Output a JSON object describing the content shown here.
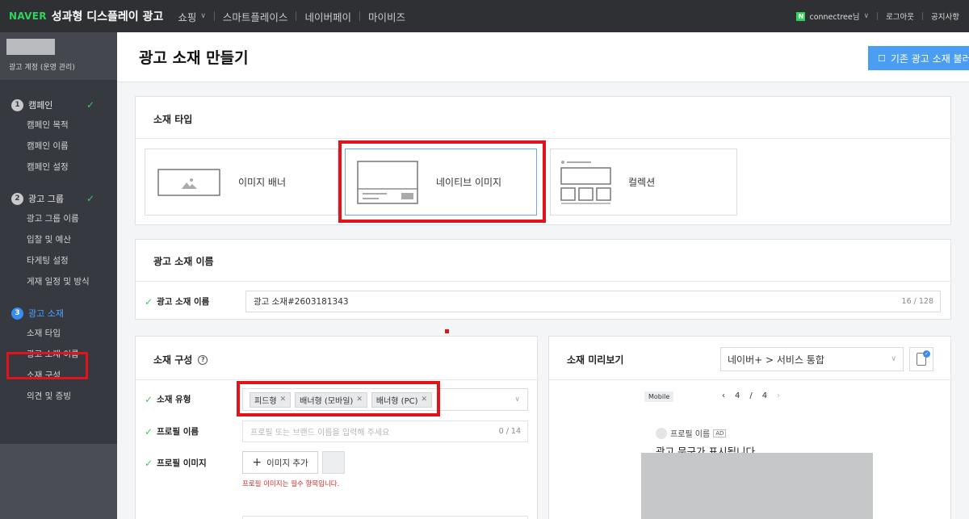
{
  "topbar": {
    "brand_naver": "NAVER",
    "brand_title": "성과형 디스플레이 광고",
    "nav": [
      {
        "label": "쇼핑"
      },
      {
        "label": "스마트플레이스"
      },
      {
        "label": "네이버페이"
      },
      {
        "label": "마이비즈"
      }
    ],
    "user": "connectree님",
    "logout": "로그아웃",
    "notice": "공지사항",
    "n_badge": "N"
  },
  "sidebar": {
    "account_label": "광고 계정 (운영 관리)",
    "sections": [
      {
        "num": "1",
        "label": "캠페인",
        "done": "✓",
        "items": [
          "캠페인 목적",
          "캠페인 이름",
          "캠페인 설정"
        ]
      },
      {
        "num": "2",
        "label": "광고 그룹",
        "done": "✓",
        "items": [
          "광고 그룹 이름",
          "입찰 및 예산",
          "타게팅 설정",
          "게재 일정 및 방식"
        ]
      },
      {
        "num": "3",
        "label": "광고 소재",
        "done": "",
        "items": [
          "소재 타입",
          "광고 소재 이름",
          "소재 구성",
          "의견 및 증빙"
        ]
      }
    ]
  },
  "header": {
    "title": "광고 소재 만들기",
    "load_button": "기존 광고 소재 불러오기"
  },
  "type_card": {
    "title": "소재 타입",
    "options": [
      {
        "label": "이미지 배너",
        "selected": false
      },
      {
        "label": "네이티브 이미지",
        "selected": true
      },
      {
        "label": "컬렉션",
        "selected": false
      }
    ]
  },
  "name_card": {
    "title": "광고 소재 이름",
    "field_label": "광고 소재 이름",
    "value": "광고 소재#2603181343",
    "counter": "16 / 128"
  },
  "compose_card": {
    "title": "소재 구성",
    "type_label": "소재 유형",
    "tags": [
      "피드형",
      "배너형 (모바일)",
      "배너형 (PC)"
    ],
    "profile_name_label": "프로필 이름",
    "profile_name_placeholder": "프로필 또는 브랜드 이름을 입력해 주세요",
    "profile_name_counter": "0 / 14",
    "profile_image_label": "프로필 이미지",
    "add_image_button": "이미지 추가",
    "error_text": "프로필 이미지는 필수 항목입니다."
  },
  "preview_card": {
    "title": "소재 미리보기",
    "placement": "네이버+ > 서비스 통합",
    "device_chip": "Mobile",
    "page_current": "4",
    "page_sep": "/",
    "page_total": "4",
    "profile_name": "프로필 이름",
    "ad_badge": "AD",
    "ad_copy": "광고 문구가 표시됩니다"
  },
  "colors": {
    "accent": "#4b9df2",
    "naver_green": "#2fd35c",
    "highlight_red": "#e0141a",
    "sidebar_bg": "#36393f"
  }
}
